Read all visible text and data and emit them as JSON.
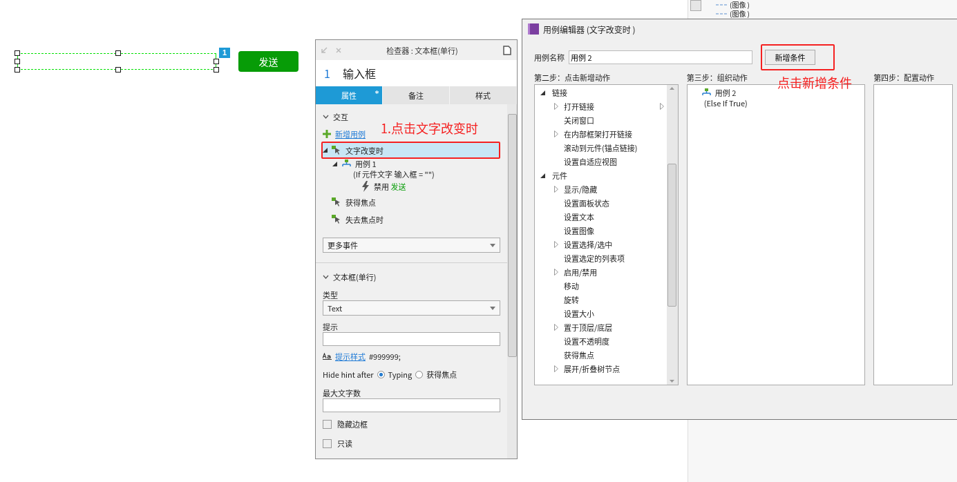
{
  "canvas": {
    "widget_badge": "1",
    "send_button": "发送",
    "textbox_selected": true
  },
  "inspector": {
    "title": "检查器 : 文本框(单行)",
    "widget_number": "1",
    "widget_name": "输入框",
    "tabs": [
      {
        "label": "属性",
        "selected": true,
        "modified": true
      },
      {
        "label": "备注",
        "selected": false,
        "modified": false
      },
      {
        "label": "样式",
        "selected": false,
        "modified": false
      }
    ],
    "interactions": {
      "header": "交互",
      "expanded": true,
      "add_case": "新增用例",
      "events": [
        {
          "kind": "event",
          "label": "文字改变时",
          "selected": true,
          "highlighted": true,
          "children": [
            {
              "kind": "case",
              "label": "用例 1",
              "condition": "(If 元件文字  输入框 = \"\")",
              "children": [
                {
                  "kind": "action",
                  "label": "禁用",
                  "target": "发送"
                }
              ]
            }
          ]
        },
        {
          "kind": "event",
          "label": "获得焦点",
          "selected": false,
          "highlighted": false
        },
        {
          "kind": "event",
          "label": "失去焦点时",
          "selected": false,
          "highlighted": false
        }
      ],
      "more_events": "更多事件"
    },
    "textbox": {
      "header": "文本框(单行)",
      "expanded": true,
      "type_label": "类型",
      "type_value": "Text",
      "hint_label": "提示",
      "hint_style_link": "提示样式",
      "hint_color": "#999999;",
      "hide_hint_label": "Hide hint after",
      "hide_hint_options": [
        {
          "label": "Typing",
          "selected": true
        },
        {
          "label": "获得焦点",
          "selected": false
        }
      ],
      "max_length_label": "最大文字数",
      "checkboxes": [
        {
          "label": "隐藏边框",
          "checked": false
        },
        {
          "label": "只读",
          "checked": false
        }
      ]
    }
  },
  "annotations": [
    {
      "text": "1.点击文字改变时"
    },
    {
      "text": "点击新增条件"
    }
  ],
  "background_window": {
    "items": [
      "(图像 )",
      "(图像 )"
    ]
  },
  "dialog": {
    "title": "用例编辑器 (文字改变时  )",
    "case_name_label": "用例名称",
    "case_name": "用例 2",
    "add_condition_button": "新增条件",
    "add_condition_highlighted": true,
    "step2_label": "第二步：点击新增动作",
    "step3_label": "第三步：组织动作",
    "step4_label": "第四步：配置动作",
    "actions": [
      {
        "label": "链接",
        "expanded": true,
        "children": [
          {
            "label": "打开链接",
            "expandable": true,
            "submenu": true
          },
          {
            "label": "关闭窗口",
            "expandable": false,
            "submenu": false
          },
          {
            "label": "在内部框架打开链接",
            "expandable": true,
            "submenu": false
          },
          {
            "label": "滚动到元件(锚点链接)",
            "expandable": false,
            "submenu": false
          },
          {
            "label": "设置自适应视图",
            "expandable": false,
            "submenu": false
          }
        ]
      },
      {
        "label": "元件",
        "expanded": true,
        "children": [
          {
            "label": "显示/隐藏",
            "expandable": true,
            "submenu": false
          },
          {
            "label": "设置面板状态",
            "expandable": false,
            "submenu": false
          },
          {
            "label": "设置文本",
            "expandable": false,
            "submenu": false
          },
          {
            "label": "设置图像",
            "expandable": false,
            "submenu": false
          },
          {
            "label": "设置选择/选中",
            "expandable": true,
            "submenu": false
          },
          {
            "label": "设置选定的列表项",
            "expandable": false,
            "submenu": false
          },
          {
            "label": "启用/禁用",
            "expandable": true,
            "submenu": false
          },
          {
            "label": "移动",
            "expandable": false,
            "submenu": false
          },
          {
            "label": "旋转",
            "expandable": false,
            "submenu": false
          },
          {
            "label": "设置大小",
            "expandable": false,
            "submenu": false
          },
          {
            "label": "置于顶层/底层",
            "expandable": true,
            "submenu": false
          },
          {
            "label": "设置不透明度",
            "expandable": false,
            "submenu": false
          },
          {
            "label": "获得焦点",
            "expandable": false,
            "submenu": false
          },
          {
            "label": "展开/折叠树节点",
            "expandable": true,
            "submenu": false
          }
        ]
      }
    ],
    "organized": [
      {
        "label": "用例 2",
        "condition": "(Else If True)"
      }
    ]
  }
}
